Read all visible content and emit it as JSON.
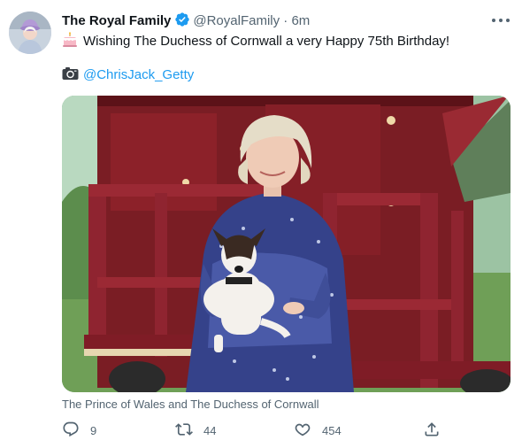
{
  "tweet": {
    "display_name": "The Royal Family",
    "handle": "@RoyalFamily",
    "separator": "·",
    "time": "6m",
    "text": "Wishing The Duchess of Cornwall a very Happy 75th Birthday!",
    "emoji": "birthday-cake-emoji",
    "credit": "@ChrisJack_Getty",
    "credit_icon": "camera-emoji",
    "caption": "The Prince of Wales and The Duchess of Cornwall",
    "verified_icon": "verified-badge-icon",
    "more_icon": "more-options-icon"
  },
  "actions": {
    "reply": {
      "icon": "reply-icon",
      "count": "9"
    },
    "retweet": {
      "icon": "retweet-icon",
      "count": "44"
    },
    "like": {
      "icon": "heart-icon",
      "count": "454"
    },
    "share": {
      "icon": "share-icon"
    }
  },
  "colors": {
    "text": "#0f1419",
    "muted": "#536471",
    "link": "#1d9bf0",
    "verified": "#1d9bf0"
  }
}
